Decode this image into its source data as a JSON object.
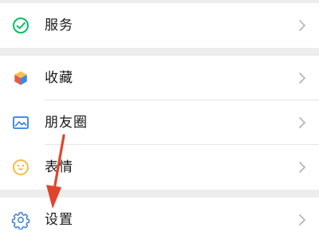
{
  "menu": {
    "services": {
      "label": "服务",
      "icon": "services-check-icon"
    },
    "favorites": {
      "label": "收藏",
      "icon": "favorites-cube-icon"
    },
    "moments": {
      "label": "朋友圈",
      "icon": "moments-picture-icon"
    },
    "stickers": {
      "label": "表情",
      "icon": "stickers-smiley-icon"
    },
    "settings": {
      "label": "设置",
      "icon": "settings-gear-icon"
    }
  },
  "colors": {
    "services_green": "#07c160",
    "moments_blue": "#2f7ee8",
    "stickers_yellow": "#f5b638",
    "settings_blue": "#3b82d6",
    "annotation_arrow": "#e0452b"
  }
}
